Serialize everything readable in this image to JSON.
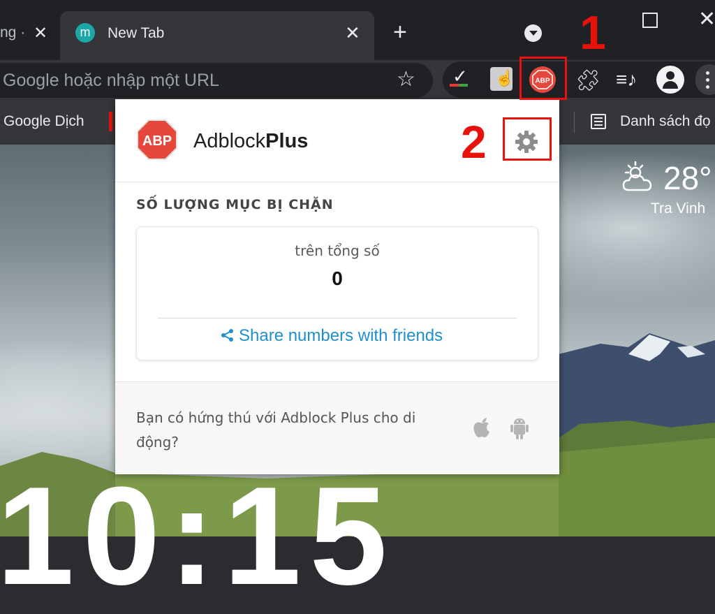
{
  "tabs": [
    {
      "title": "ng ·",
      "close": "✕"
    },
    {
      "title": "New Tab",
      "favicon": "m",
      "close": "✕"
    }
  ],
  "tabstrip": {
    "new_tab": "+",
    "close_window": "✕"
  },
  "omnibox": {
    "placeholder": "Google hoặc nhập một URL",
    "star": "☆"
  },
  "toolbar_icons": [
    "check-extension-icon",
    "touch-extension-icon",
    "adblock-plus-icon",
    "puzzle-icon",
    "media-control-icon",
    "profile-avatar-icon",
    "menu-icon"
  ],
  "bookmarks": {
    "item1": "Google Dịch",
    "reading_list": "Danh sách đọ"
  },
  "weather": {
    "temperature": "28°",
    "city": "Tra Vinh"
  },
  "clock": {
    "time": "10:15"
  },
  "annotations": {
    "step1": "1",
    "step2": "2",
    "highlight_color": "#e8120c"
  },
  "popup": {
    "brand_regular": "Adblock",
    "brand_bold": "Plus",
    "logo_text": "ABP",
    "section_title": "SỐ LƯỢNG MỤC BỊ CHẶN",
    "total_label": "trên tổng số",
    "total_value": "0",
    "share_link": "Share numbers with friends",
    "mobile_question": "Bạn có hứng thú với Adblock Plus cho di động?"
  },
  "colors": {
    "abp_red": "#e6473d",
    "link_blue": "#1f8fcf",
    "chrome_dark": "#202124",
    "chrome_toolbar": "#35363a"
  }
}
